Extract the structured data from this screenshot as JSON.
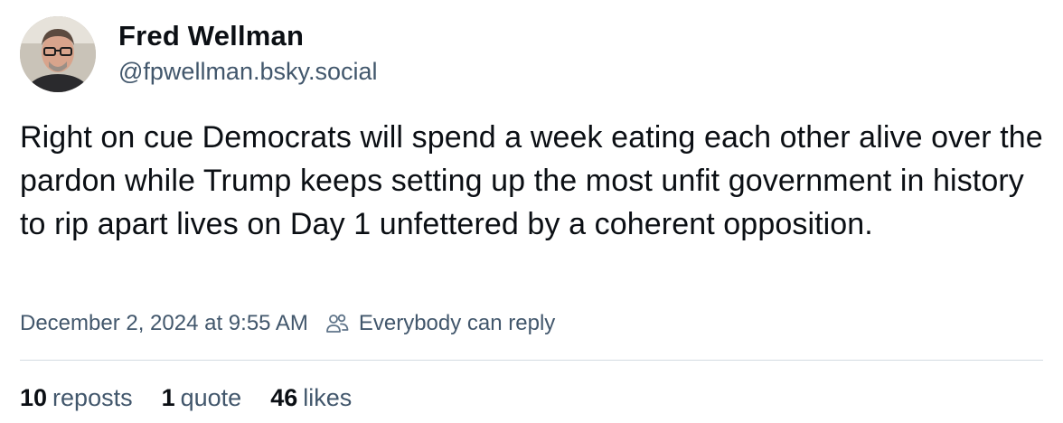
{
  "author": {
    "name": "Fred Wellman",
    "handle": "@fpwellman.bsky.social"
  },
  "post": {
    "text": "Right on cue Democrats will spend a week eating each other alive over the pardon while Trump keeps setting up the most unfit government in history to rip apart lives on Day 1 unfettered by a coherent opposition.",
    "timestamp": "December 2, 2024 at 9:55 AM",
    "reply_setting": "Everybody can reply"
  },
  "stats": {
    "reposts_count": "10",
    "reposts_label": "reposts",
    "quotes_count": "1",
    "quotes_label": "quote",
    "likes_count": "46",
    "likes_label": "likes"
  },
  "icons": {
    "reply_setting_icon": "people-icon"
  },
  "colors": {
    "text_primary": "#0b0f14",
    "text_secondary": "#42576c",
    "divider": "#d4dbe2"
  }
}
